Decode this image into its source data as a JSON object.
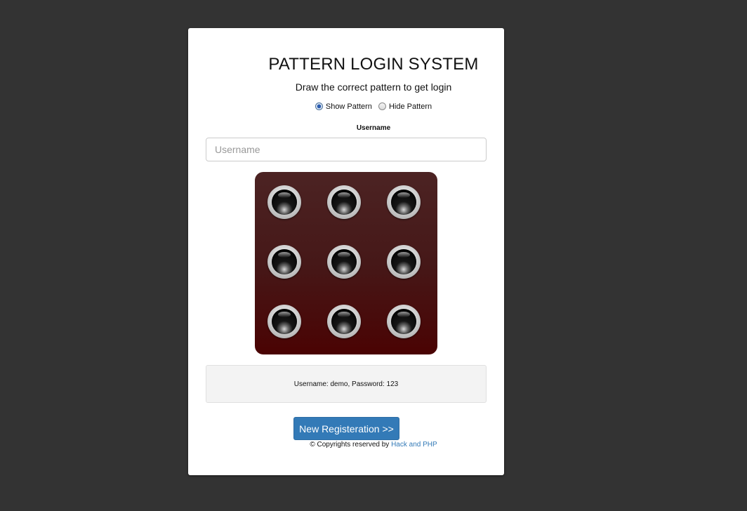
{
  "header": {
    "title": "PATTERN LOGIN SYSTEM",
    "subtitle": "Draw the correct pattern to get login"
  },
  "pattern_visibility": {
    "options": [
      {
        "label": "Show Pattern",
        "checked": true
      },
      {
        "label": "Hide Pattern",
        "checked": false
      }
    ]
  },
  "username": {
    "label": "Username",
    "placeholder": "Username",
    "value": ""
  },
  "hint": {
    "text": "Username: demo, Password: 123"
  },
  "register": {
    "label": "New Registeration >>"
  },
  "footer": {
    "prefix": "© Copyrights reserved by",
    "link_text": "Hack and PHP"
  },
  "colors": {
    "page_background": "#333333",
    "card_background": "#ffffff",
    "pattern_pad_top": "#4c2323",
    "pattern_pad_bottom": "#4a0303",
    "primary_button": "#337ab7",
    "link": "#337ab7",
    "hint_background": "#f3f3f3"
  }
}
